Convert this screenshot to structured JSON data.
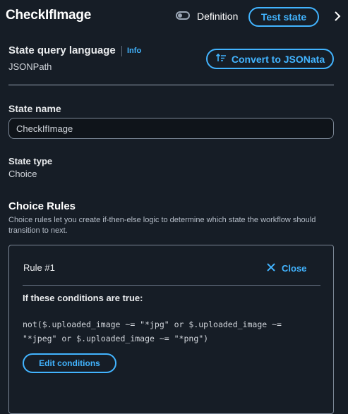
{
  "header": {
    "title": "CheckIfImage",
    "definition_toggle_label": "Definition",
    "test_state_label": "Test state"
  },
  "query_language": {
    "label": "State query language",
    "info_label": "Info",
    "value": "JSONPath",
    "convert_label": "Convert to JSONata"
  },
  "state_name": {
    "label": "State name",
    "value": "CheckIfImage"
  },
  "state_type": {
    "label": "State type",
    "value": "Choice"
  },
  "choice_rules": {
    "title": "Choice Rules",
    "description": "Choice rules let you create if-then-else logic to determine which state the workflow should transition to next.",
    "rules": [
      {
        "label": "Rule #1",
        "close_label": "Close",
        "conditions_heading": "If these conditions are true:",
        "condition_expression": "not($.uploaded_image ~= \"*jpg\" or $.uploaded_image ~=\n\"*jpeg\" or $.uploaded_image ~= \"*png\")",
        "edit_conditions_label": "Edit conditions"
      }
    ]
  },
  "colors": {
    "background": "#161d26",
    "accent": "#42b4ff",
    "text": "#d1d5db",
    "border": "#7d8998"
  },
  "icons": [
    "chevron-right-icon",
    "convert-icon",
    "close-icon"
  ]
}
